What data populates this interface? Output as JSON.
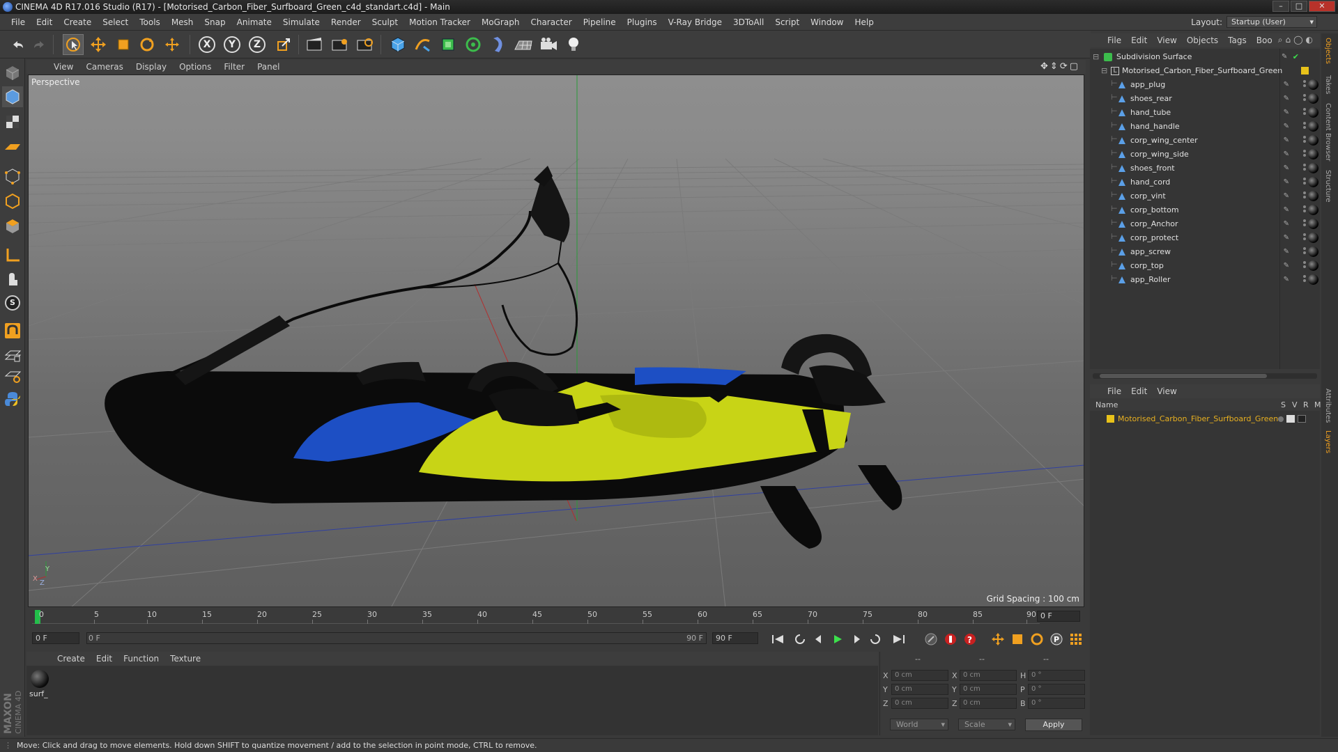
{
  "window": {
    "title": "CINEMA 4D R17.016 Studio (R17) - [Motorised_Carbon_Fiber_Surfboard_Green_c4d_standart.c4d] - Main",
    "buttons": [
      "–",
      "□",
      "✕"
    ]
  },
  "menubar": {
    "items": [
      "File",
      "Edit",
      "Create",
      "Select",
      "Tools",
      "Mesh",
      "Snap",
      "Animate",
      "Simulate",
      "Render",
      "Sculpt",
      "Motion Tracker",
      "MoGraph",
      "Character",
      "Pipeline",
      "Plugins",
      "V-Ray Bridge",
      "3DToAll",
      "Script",
      "Window",
      "Help"
    ],
    "layout_label": "Layout:",
    "layout_value": "Startup (User)"
  },
  "toolbar": {
    "axis_x": "X",
    "axis_y": "Y",
    "axis_z": "Z"
  },
  "viewport": {
    "menu": [
      "View",
      "Cameras",
      "Display",
      "Options",
      "Filter",
      "Panel"
    ],
    "label": "Perspective",
    "grid_spacing": "Grid Spacing : 100 cm",
    "axis_y": "Y",
    "axis_x": "X",
    "axis_z": "Z"
  },
  "timeline": {
    "ticks": [
      "0",
      "5",
      "10",
      "15",
      "20",
      "25",
      "30",
      "35",
      "40",
      "45",
      "50",
      "55",
      "60",
      "65",
      "70",
      "75",
      "80",
      "85",
      "90"
    ],
    "current_frame": "0 F",
    "start_field": "0 F",
    "range_start": "0 F",
    "range_end": "90 F",
    "end_field": "90 F"
  },
  "material_manager": {
    "menu": [
      "Create",
      "Edit",
      "Function",
      "Texture"
    ],
    "materials": [
      {
        "name": "surf_"
      }
    ]
  },
  "coordinates": {
    "header": [
      "--",
      "--",
      "--"
    ],
    "rows": [
      {
        "a": "X",
        "v1": "0 cm",
        "b": "X",
        "v2": "0 cm",
        "c": "H",
        "v3": "0 °"
      },
      {
        "a": "Y",
        "v1": "0 cm",
        "b": "Y",
        "v2": "0 cm",
        "c": "P",
        "v3": "0 °"
      },
      {
        "a": "Z",
        "v1": "0 cm",
        "b": "Z",
        "v2": "0 cm",
        "c": "B",
        "v3": "0 °"
      }
    ],
    "mode": "World",
    "scale": "Scale",
    "apply": "Apply"
  },
  "object_manager": {
    "menu": [
      "File",
      "Edit",
      "View",
      "Objects",
      "Tags",
      "Boo"
    ],
    "root": "Subdivision Surface",
    "group": "Motorised_Carbon_Fiber_Surfboard_Green",
    "children": [
      "app_plug",
      "shoes_rear",
      "hand_tube",
      "hand_handle",
      "corp_wing_center",
      "corp_wing_side",
      "shoes_front",
      "hand_cord",
      "corp_vint",
      "corp_bottom",
      "corp_Anchor",
      "corp_protect",
      "app_screw",
      "corp_top",
      "app_Roller"
    ]
  },
  "layer_manager": {
    "menu": [
      "File",
      "Edit",
      "View"
    ],
    "columns": {
      "name": "Name",
      "s": "S",
      "v": "V",
      "r": "R",
      "m": "M"
    },
    "layers": [
      {
        "name": "Motorised_Carbon_Fiber_Surfboard_Green",
        "color": "#e8c21a"
      }
    ]
  },
  "side_tabs": [
    "Objects",
    "Takes",
    "Content Browser",
    "Structure",
    "Attributes",
    "Layers"
  ],
  "status": "Move: Click and drag to move elements. Hold down SHIFT to quantize movement / add to the selection in point mode, CTRL to remove.",
  "colors": {
    "accent": "#f0a020",
    "yellow": "#c8d416",
    "blue": "#1d4fc4",
    "layer": "#e8c21a"
  }
}
